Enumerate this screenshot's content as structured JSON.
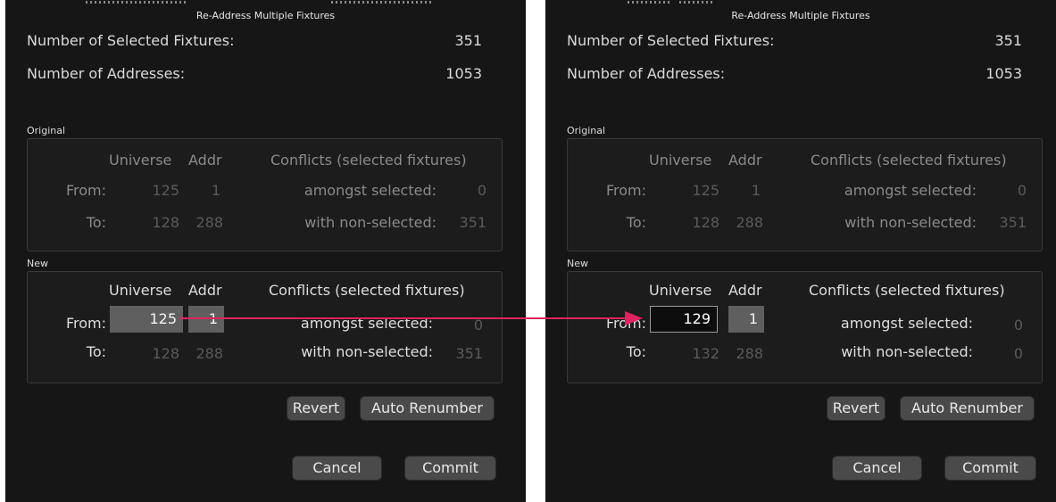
{
  "dialog_title": "Re-Address Multiple Fixtures",
  "labels": {
    "selected_fixtures": "Number of Selected Fixtures:",
    "addresses": "Number of Addresses:",
    "original": "Original",
    "new": "New",
    "universe": "Universe",
    "addr": "Addr",
    "conflicts": "Conflicts (selected fixtures)",
    "from": "From:",
    "to": "To:",
    "amongst_selected": "amongst selected:",
    "with_non_selected": "with non-selected:"
  },
  "buttons": {
    "revert": "Revert",
    "auto_renumber": "Auto Renumber",
    "cancel": "Cancel",
    "commit": "Commit"
  },
  "colors": {
    "arrow": "#e0245e",
    "background": "#161616",
    "field": "#5f5f5f"
  },
  "before": {
    "selected_fixtures": "351",
    "addresses": "1053",
    "original": {
      "from_universe": "125",
      "from_addr": "1",
      "to_universe": "128",
      "to_addr": "288",
      "amongst_selected": "0",
      "with_non_selected": "351"
    },
    "new": {
      "from_universe": "125",
      "from_addr": "1",
      "to_universe": "128",
      "to_addr": "288",
      "amongst_selected": "0",
      "with_non_selected": "351"
    }
  },
  "after": {
    "selected_fixtures": "351",
    "addresses": "1053",
    "original": {
      "from_universe": "125",
      "from_addr": "1",
      "to_universe": "128",
      "to_addr": "288",
      "amongst_selected": "0",
      "with_non_selected": "351"
    },
    "new": {
      "from_universe": "129",
      "from_addr": "1",
      "to_universe": "132",
      "to_addr": "288",
      "amongst_selected": "0",
      "with_non_selected": "0"
    }
  }
}
